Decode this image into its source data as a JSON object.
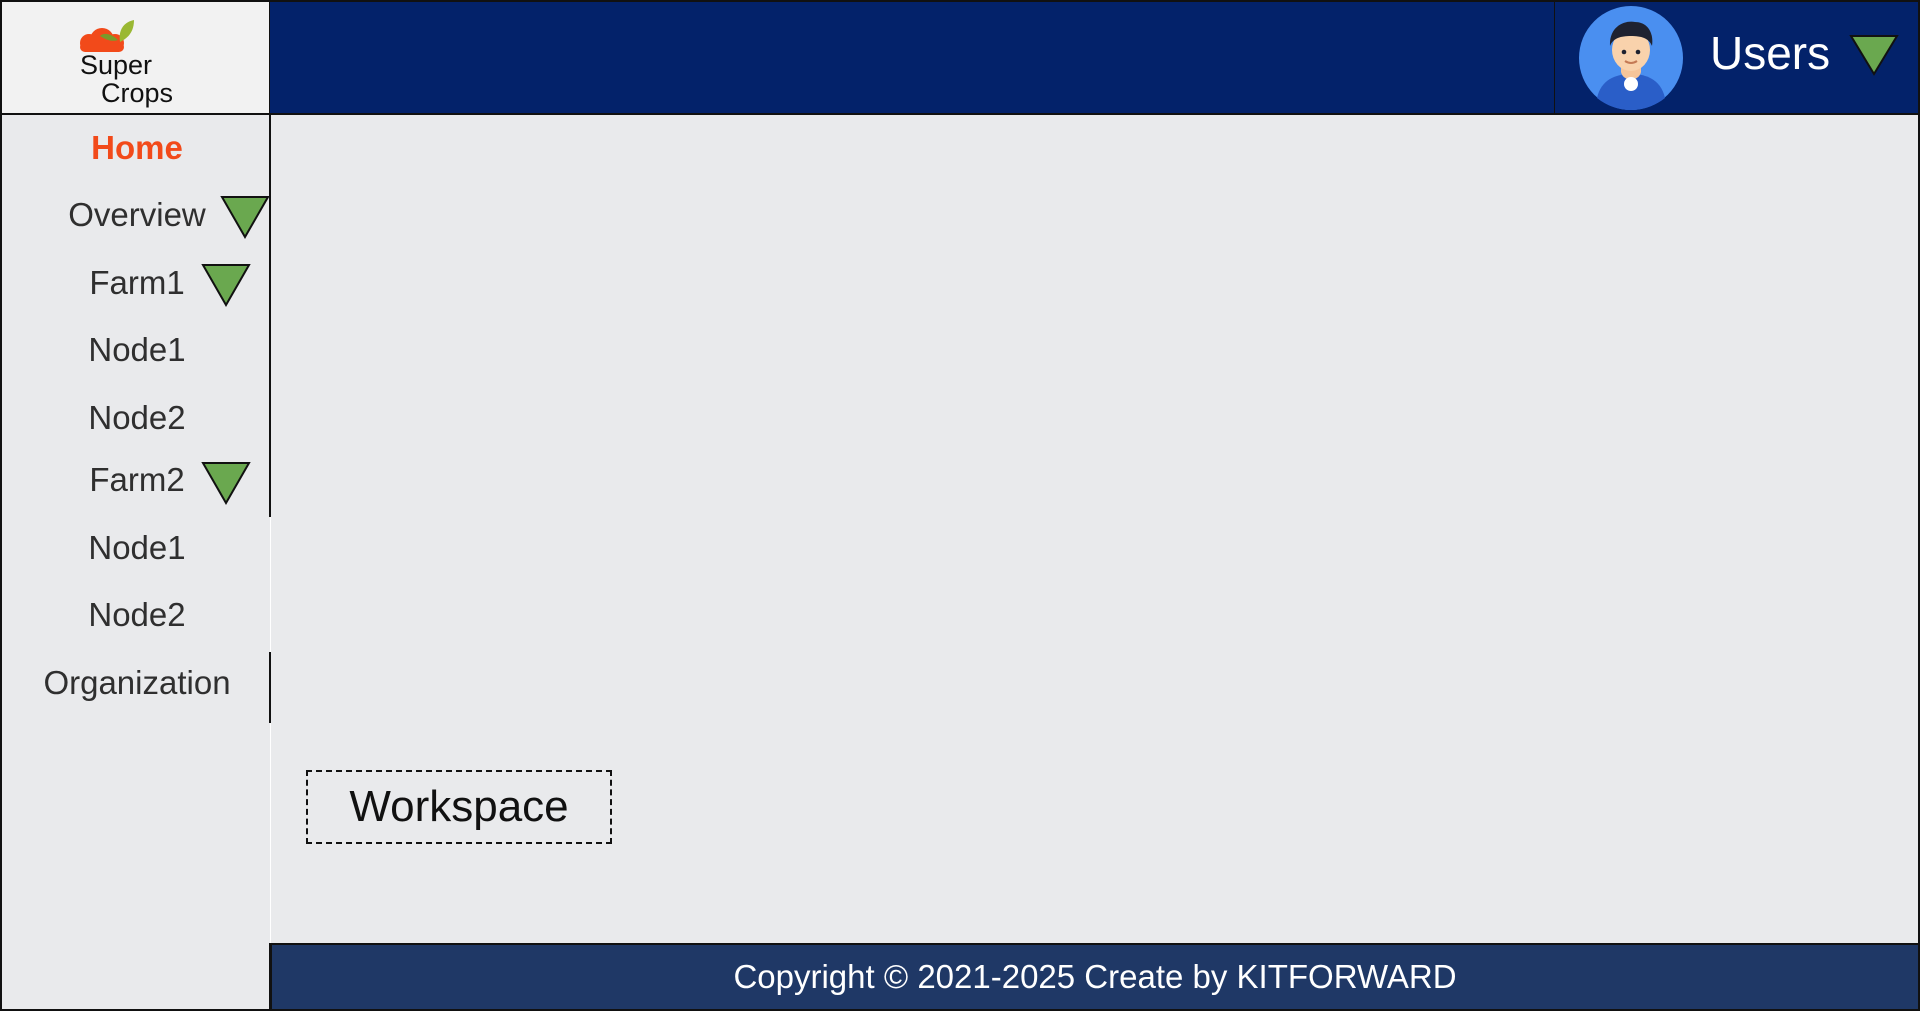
{
  "brand": {
    "logo_line1": "Super",
    "logo_line2": "Crops",
    "cloud_color": "#f24a1a",
    "leaf_color": "#9ab833"
  },
  "header": {
    "user_label": "Users",
    "user_icon": "avatar-icon",
    "dropdown_icon": "chevron-down-icon",
    "background": "#03226a"
  },
  "sidebar": {
    "items": [
      {
        "label": "Home",
        "active": true,
        "expandable": false
      },
      {
        "label": "Overview",
        "active": false,
        "expandable": true
      },
      {
        "label": "Farm1",
        "active": false,
        "expandable": true
      },
      {
        "label": "Node1",
        "active": false,
        "expandable": false
      },
      {
        "label": "Node2",
        "active": false,
        "expandable": false
      },
      {
        "label": "Farm2",
        "active": false,
        "expandable": true
      },
      {
        "label": "Node1",
        "active": false,
        "expandable": false
      },
      {
        "label": "Node2",
        "active": false,
        "expandable": false
      },
      {
        "label": "Organization",
        "active": false,
        "expandable": false
      }
    ],
    "active_color": "#f24a1a",
    "caret_color": "#6aa84f"
  },
  "main": {
    "workspace_label": "Workspace"
  },
  "footer": {
    "copyright": "Copyright © 2021-2025 Create by KITFORWARD",
    "background": "#1f3866"
  }
}
